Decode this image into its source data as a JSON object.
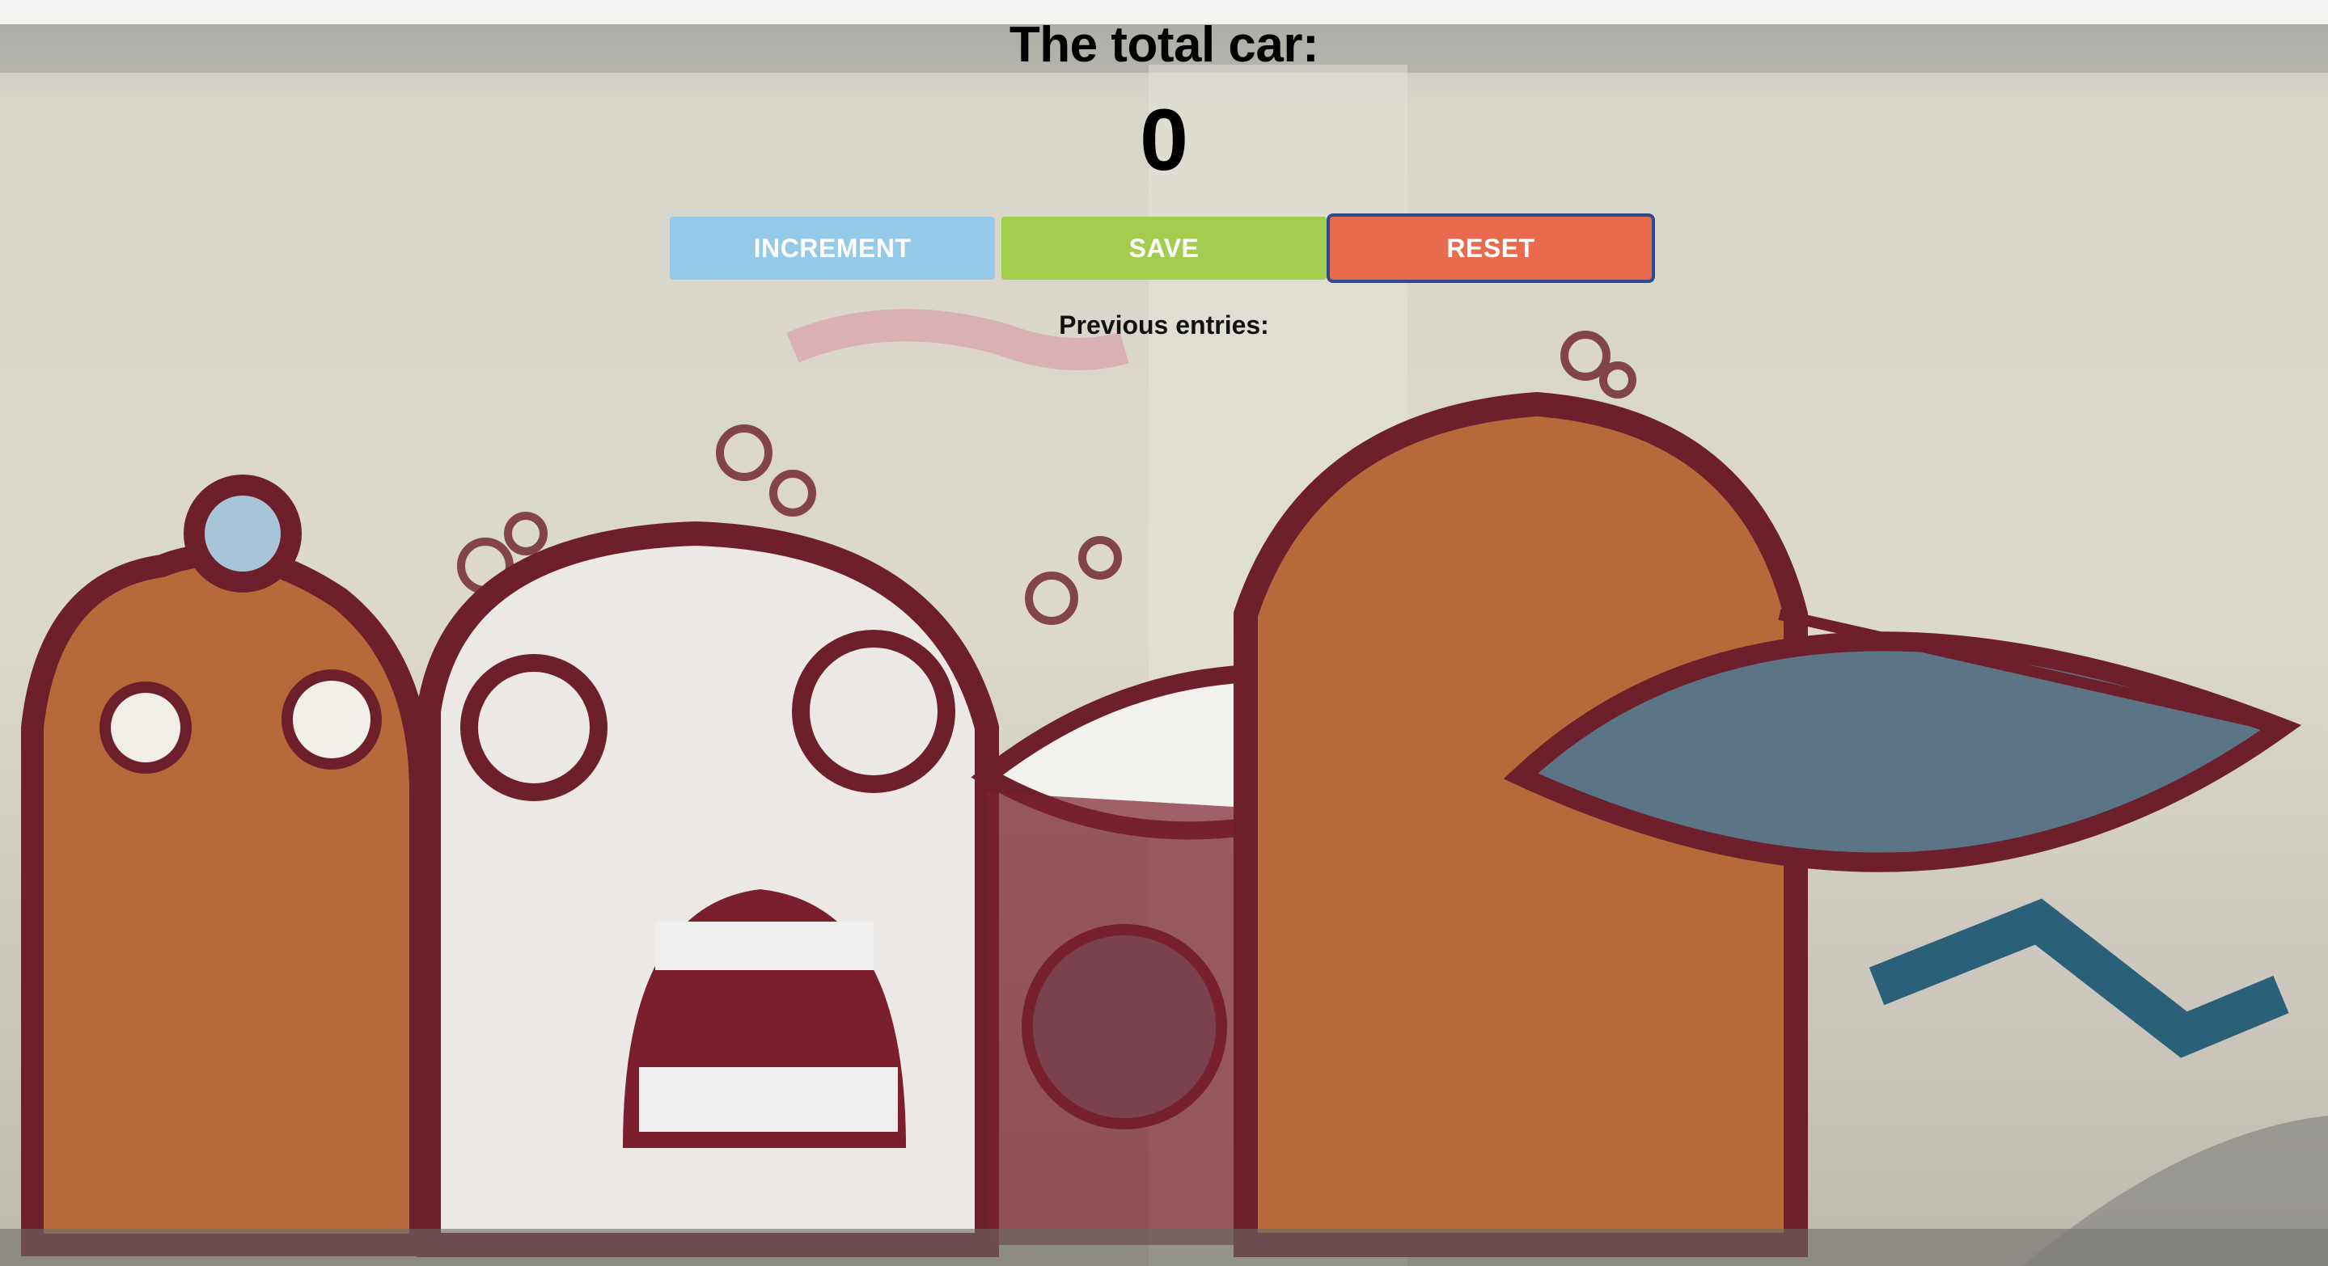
{
  "heading": {
    "title": "The total car:"
  },
  "counter": {
    "value": "0"
  },
  "buttons": {
    "increment_label": "INCREMENT",
    "save_label": "SAVE",
    "reset_label": "RESET"
  },
  "entries": {
    "label": "Previous entries:"
  },
  "colors": {
    "increment": "#94c9e8",
    "save": "#a3cd4f",
    "reset": "#e96b4f",
    "reset_focus_ring": "#2c4c8e"
  }
}
